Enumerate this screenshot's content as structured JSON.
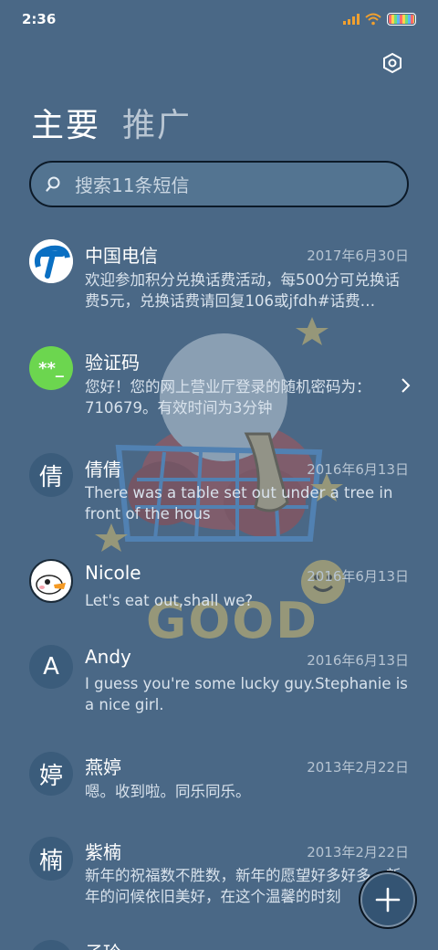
{
  "status_bar": {
    "time": "2:36"
  },
  "header": {
    "tabs": [
      {
        "label": "主要",
        "active": true
      },
      {
        "label": "推广",
        "active": false
      }
    ],
    "settings_icon": "settings-hexagon-icon"
  },
  "search": {
    "placeholder": "搜索11条短信",
    "icon": "search-icon"
  },
  "conversations": [
    {
      "name": "中国电信",
      "date": "2017年6月30日",
      "preview": "欢迎参加积分兑换话费活动，每500分可兑换话费5元，兑换话费请回复106或jfdh#话费…",
      "avatar": "china-telecom-logo"
    },
    {
      "name": "验证码",
      "date": "",
      "preview": "您好！您的网上营业厅登录的随机密码为：710679。有效时间为3分钟",
      "avatar_text": "**_"
    },
    {
      "name": "倩倩",
      "date": "2016年6月13日",
      "preview": "There was a table set out under a tree in front of the hous",
      "avatar_text": "倩"
    },
    {
      "name": "Nicole",
      "date": "2016年6月13日",
      "preview": "Let's eat out,shall we?",
      "avatar": "duck-avatar"
    },
    {
      "name": "Andy",
      "date": "2016年6月13日",
      "preview": "I guess you're some lucky guy.Stephanie is a nice girl.",
      "avatar_text": "A"
    },
    {
      "name": "燕婷",
      "date": "2013年2月22日",
      "preview": "嗯。收到啦。同乐同乐。",
      "avatar_text": "婷"
    },
    {
      "name": "紫楠",
      "date": "2013年2月22日",
      "preview": "新年的祝福数不胜数，新年的愿望好多好多，新年的问候依旧美好，在这个温馨的时刻",
      "avatar_text": "楠"
    },
    {
      "name": "子玲",
      "date": "",
      "preview": "",
      "avatar_text": ""
    }
  ],
  "wallpaper_text": "GOOD",
  "fab": {
    "icon": "plus-icon"
  },
  "colors": {
    "background": "#4a6886",
    "search_bg": "#537491",
    "verify_green": "#6cd64f",
    "fab_bg": "#345473"
  }
}
